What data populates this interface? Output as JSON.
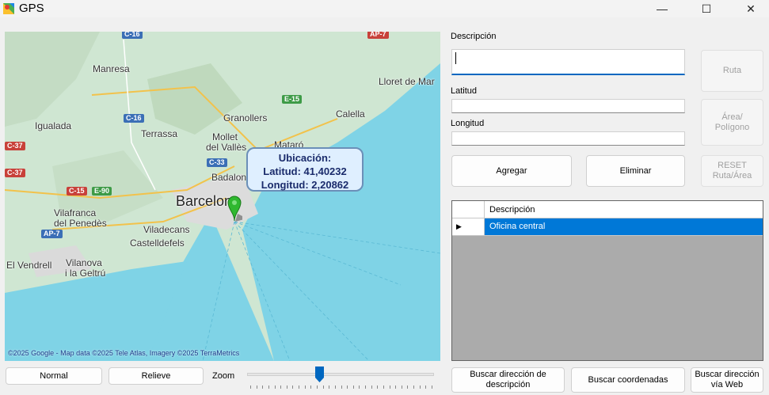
{
  "window": {
    "title": "GPS",
    "minimize_glyph": "—",
    "maximize_glyph": "☐",
    "close_glyph": "✕"
  },
  "map": {
    "place_labels": [
      "Manresa",
      "Lloret de Mar",
      "Igualada",
      "Granollers",
      "Calella",
      "Terrassa",
      "Mollet",
      "del Vallès",
      "Mataró",
      "Badalona",
      "Barcelona",
      "Vilafranca",
      "del Penedès",
      "Viladecans",
      "Castelldefels",
      "El Vendrell",
      "Vilanova",
      "i la Geltrú"
    ],
    "road_labels": [
      "C-16",
      "AP-7",
      "E-15",
      "C-16",
      "C-37",
      "C-33",
      "C-37",
      "C-15",
      "E-90",
      "AP-7"
    ],
    "marker_icon": "map-pin-icon",
    "callout": {
      "line1": "Ubicación:",
      "line2": "Latitud: 41,40232",
      "line3": "Longitud: 2,20862"
    },
    "copyright": "©2025 Google - Map data ©2025 Tele Atlas, Imagery ©2025 TerraMetrics",
    "colors": {
      "land": "#cfe6d2",
      "sea": "#7fd3e6",
      "urban": "#dcdcdc",
      "marker": "#2fb82f"
    }
  },
  "form": {
    "descripcion_label": "Descripción",
    "descripcion_value": "",
    "latitud_label": "Latitud",
    "latitud_value": "",
    "longitud_label": "Longitud",
    "longitud_value": ""
  },
  "buttons": {
    "ruta": "Ruta",
    "area_line1": "Área/",
    "area_line2": "Polígono",
    "reset_line1": "RESET",
    "reset_line2": "Ruta/Área",
    "agregar": "Agregar",
    "eliminar": "Eliminar",
    "buscar_desc_line1": "Buscar dirección de",
    "buscar_desc_line2": "descripción",
    "buscar_coord": "Buscar coordenadas",
    "buscar_web_line1": "Buscar dirección",
    "buscar_web_line2": "vía Web",
    "normal": "Normal",
    "relieve": "Relieve"
  },
  "grid": {
    "column_header": "Descripción",
    "rows": [
      {
        "descripcion": "Oficina central",
        "selected": true
      }
    ],
    "row_indicator": "▶"
  },
  "zoom": {
    "label": "Zoom",
    "level_fraction": 0.38
  }
}
